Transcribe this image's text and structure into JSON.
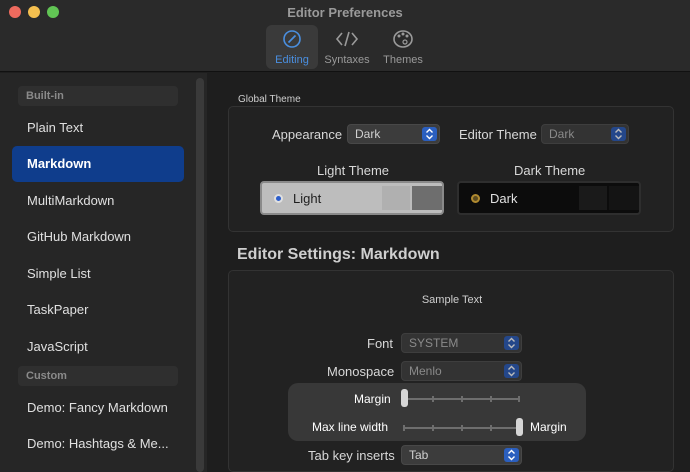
{
  "window": {
    "title": "Editor Preferences"
  },
  "toolbar": {
    "tabs": [
      {
        "label": "Editing",
        "icon": "pencil-circle-icon",
        "active": true
      },
      {
        "label": "Syntaxes",
        "icon": "code-brackets-icon",
        "active": false
      },
      {
        "label": "Themes",
        "icon": "palette-icon",
        "active": false
      }
    ]
  },
  "sidebar": {
    "builtin_header": "Built-in",
    "builtin_items": [
      "Plain Text",
      "Markdown",
      "MultiMarkdown",
      "GitHub Markdown",
      "Simple List",
      "TaskPaper",
      "JavaScript"
    ],
    "selected": "Markdown",
    "custom_header": "Custom",
    "custom_items": [
      "Demo: Fancy Markdown",
      "Demo: Hashtags & Me..."
    ]
  },
  "global_theme": {
    "label": "Global Theme",
    "appearance_label": "Appearance",
    "appearance_value": "Dark",
    "editor_theme_label": "Editor Theme",
    "editor_theme_value": "Dark",
    "light_theme_label": "Light Theme",
    "light_theme_value": "Light",
    "dark_theme_label": "Dark Theme",
    "dark_theme_value": "Dark"
  },
  "editor_settings": {
    "heading": "Editor Settings: Markdown",
    "sample_text": "Sample Text",
    "font_label": "Font",
    "font_value": "SYSTEM",
    "monospace_label": "Monospace",
    "monospace_value": "Menlo",
    "margin_label": "Margin",
    "margin_level": 0,
    "max_line_width_label": "Max line width",
    "max_line_width_level": 1,
    "max_line_width_value": "Margin",
    "tab_key_label": "Tab key inserts",
    "tab_key_value": "Tab"
  },
  "colors": {
    "accent": "#2b5fbf",
    "selection": "#0f3d8c",
    "active_tab_text": "#4a8fe0"
  }
}
